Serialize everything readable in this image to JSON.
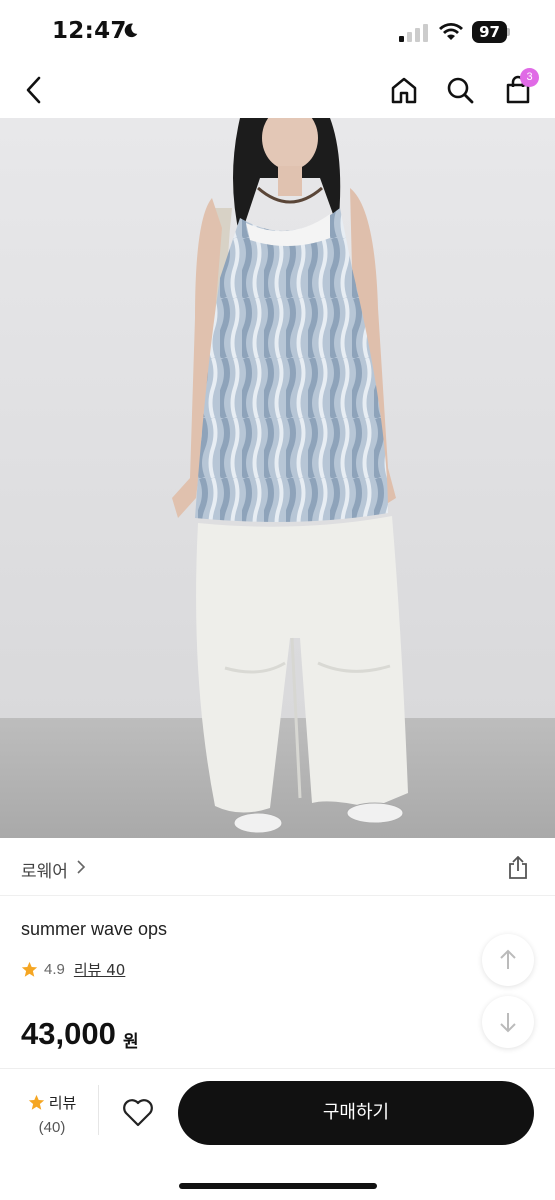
{
  "status_bar": {
    "time": "12:47",
    "battery": "97"
  },
  "nav": {
    "cart_badge": "3",
    "icons": [
      "chevron-left-icon",
      "home-icon",
      "search-icon",
      "shopping-bag-icon"
    ]
  },
  "product": {
    "brand": "로웨어",
    "title": "summer wave ops",
    "rating": "4.9",
    "review_link": "리뷰 40",
    "price": "43,000",
    "currency": "원"
  },
  "bottom_bar": {
    "review_label": "리뷰",
    "review_count": "(40)",
    "buy_label": "구매하기"
  },
  "colors": {
    "accent_badge": "#e06ae6",
    "star": "#f5a623",
    "button": "#111111"
  }
}
